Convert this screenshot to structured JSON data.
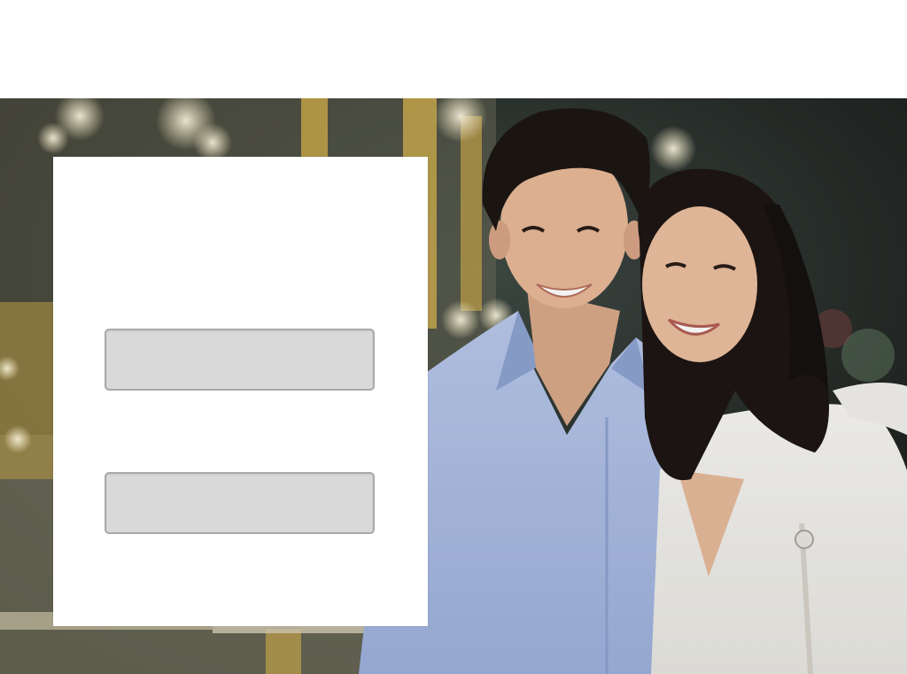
{
  "header": {},
  "hero": {
    "photo_icon": "couple-photo",
    "colors": {
      "background": "#2b2f2a",
      "shirt_blue": "#aebfe6",
      "blouse_white": "#f1f1ef",
      "hair": "#1d1714",
      "skin": "#e5b695",
      "bokeh": "#fff7d6",
      "gold": "#c9a84b"
    }
  },
  "login_panel": {
    "fields": [
      {
        "value": "",
        "placeholder": ""
      },
      {
        "value": "",
        "placeholder": ""
      }
    ]
  }
}
